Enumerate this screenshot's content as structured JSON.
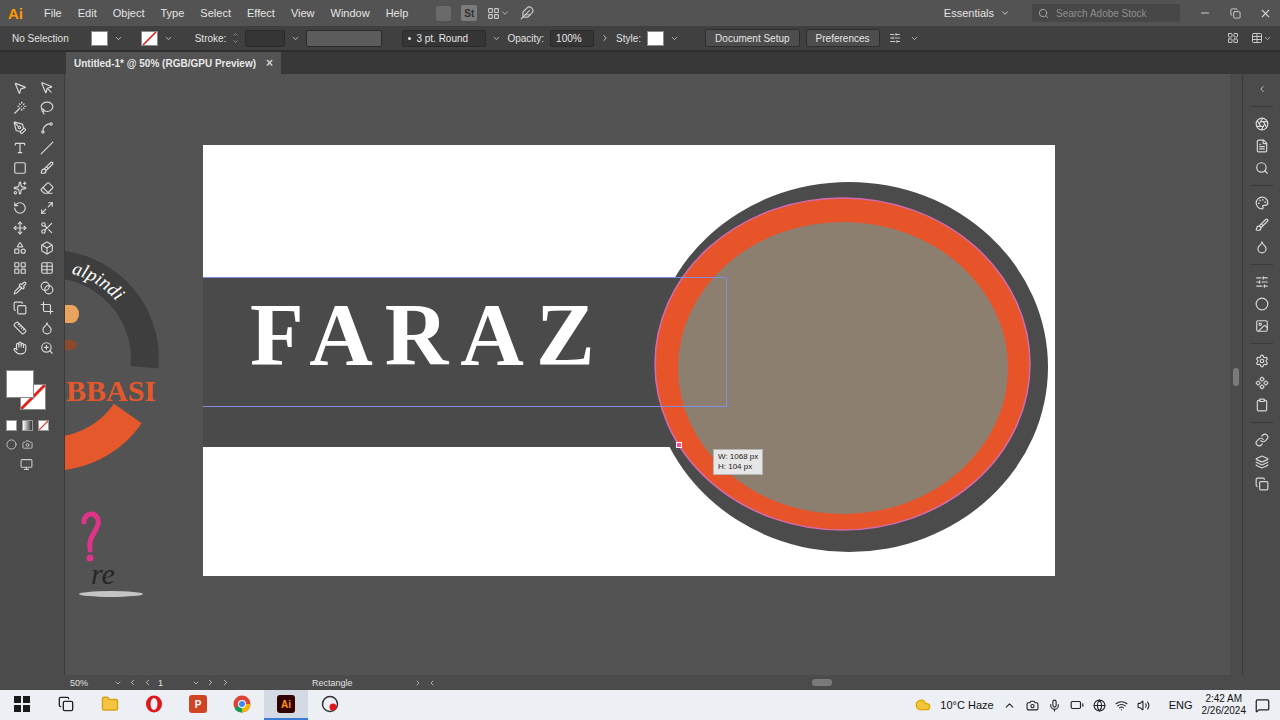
{
  "app": {
    "logo": "Ai",
    "stock_icon": "St",
    "workspace": "Essentials"
  },
  "menu": [
    "File",
    "Edit",
    "Object",
    "Type",
    "Select",
    "Effect",
    "View",
    "Window",
    "Help"
  ],
  "search": {
    "placeholder": "Search Adobe Stock"
  },
  "control_bar": {
    "selection": "No Selection",
    "stroke_label": "Stroke:",
    "brush": "3 pt. Round",
    "opacity_label": "Opacity:",
    "opacity": "100%",
    "style_label": "Style:",
    "buttons": [
      "Document Setup",
      "Preferences"
    ]
  },
  "document_tabs": [
    {
      "title": "Untitled-1* @ 50% (RGB/GPU Preview)",
      "close": "×",
      "selected": true
    }
  ],
  "artboard": {
    "banner_text": "FARAZ",
    "size_tooltip": [
      "W: 1068 px",
      "H: 104 px"
    ]
  },
  "pasteboard_texts": [
    {
      "text": "alpindi",
      "kind": "arc"
    },
    {
      "text": "BBASI",
      "kind": "title"
    },
    {
      "text": "re",
      "kind": "script"
    }
  ],
  "status_bar": {
    "zoom": "50%",
    "artboard": "1",
    "tool": "Rectangle"
  },
  "taskbar": {
    "app_labels": [
      "P",
      "Ai"
    ],
    "weather": "10°C Haze",
    "language": "ENG",
    "time": "2:42 AM",
    "date": "2/26/2024"
  }
}
